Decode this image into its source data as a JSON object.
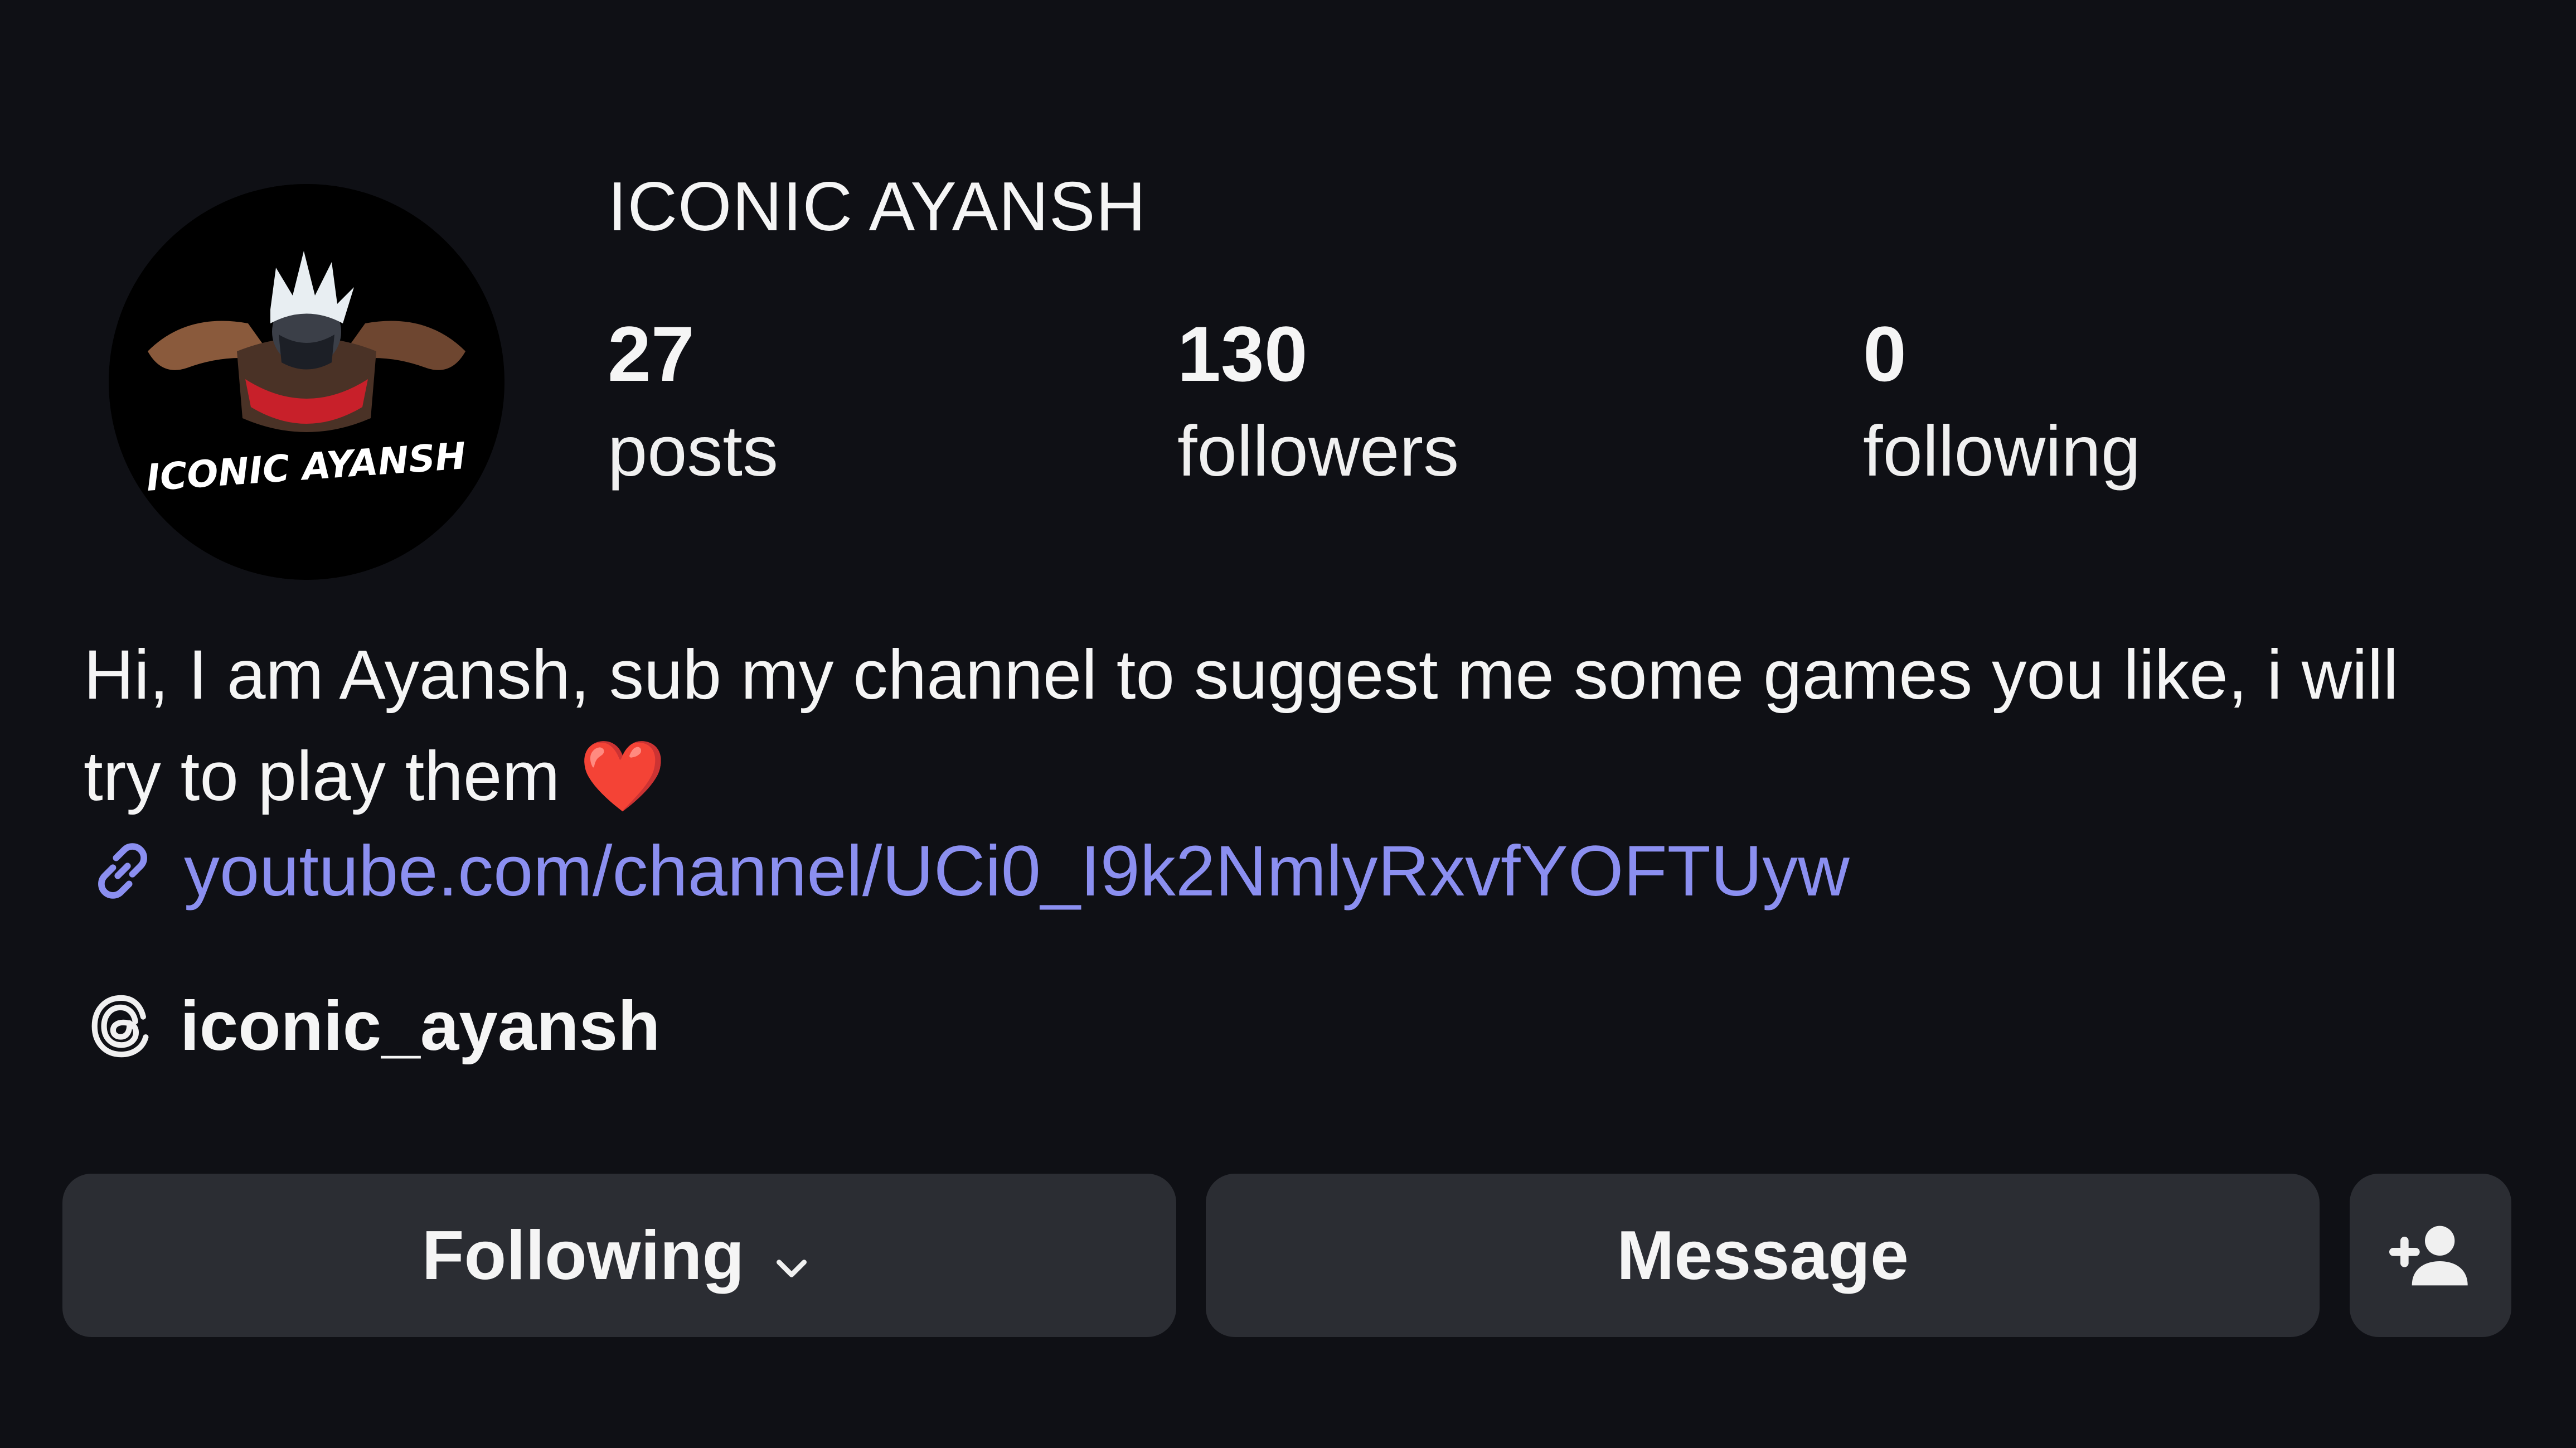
{
  "profile": {
    "display_name": "ICONIC AYANSH",
    "avatar_text": "ICONIC AYANSH",
    "stats": {
      "posts": {
        "value": "27",
        "label": "posts"
      },
      "followers": {
        "value": "130",
        "label": "followers"
      },
      "following": {
        "value": "0",
        "label": "following"
      }
    },
    "bio": {
      "text": "Hi, I am Ayansh, sub my channel to suggest me some games you like, i will try to play them",
      "emoji": "❤️"
    },
    "link": {
      "text": "youtube.com/channel/UCi0_I9k2NmlyRxvfYOFTUyw",
      "icon": "link-icon"
    },
    "threads": {
      "handle": "iconic_ayansh",
      "icon": "threads-icon"
    }
  },
  "actions": {
    "following_label": "Following",
    "message_label": "Message",
    "add_user_icon": "add-user-icon"
  },
  "colors": {
    "background": "#0f1015",
    "button": "#2b2d33",
    "link": "#8b8ff0",
    "heart": "#e0242c"
  }
}
